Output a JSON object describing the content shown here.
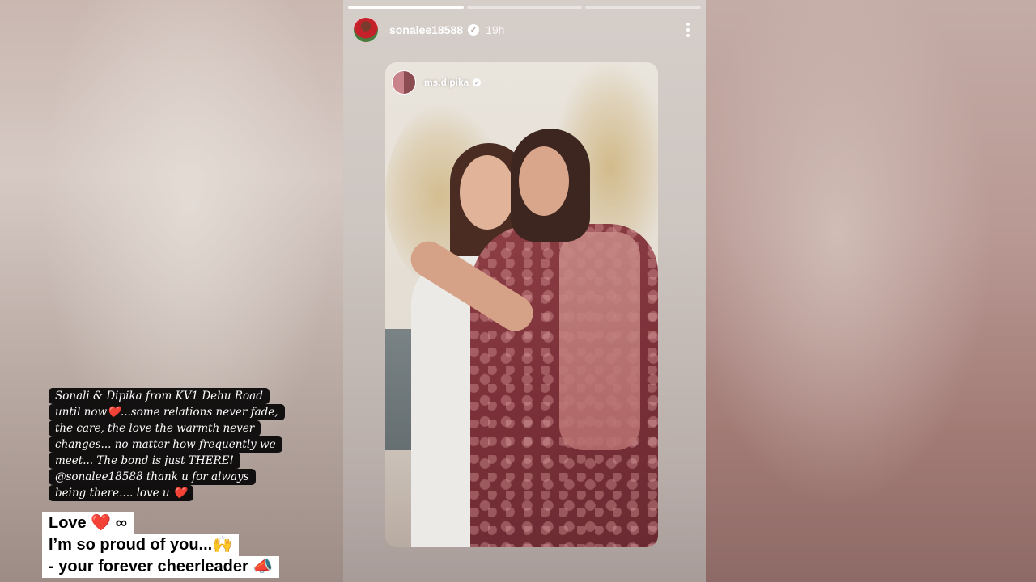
{
  "story": {
    "username": "sonalee18588",
    "time_ago": "19h",
    "progress": {
      "segments_total": 3,
      "segments_completed": 1
    }
  },
  "shared_post": {
    "username": "ms.dipika",
    "caption_lines": [
      "Sonali & Dipika from KV1 Dehu Road",
      "until now❤️...some relations never fade,",
      "the care, the love the warmth never",
      "changes... no matter how frequently we",
      "meet... The bond is just THERE!",
      "@sonalee18588 thank u for always",
      "being there.... love u ❤️"
    ]
  },
  "sticker": {
    "line1": "Love ❤️ ∞",
    "line2": "I’m so proud of you...🙌",
    "line3": "- your forever cheerleader 📣"
  },
  "icons": [
    "verified-badge-icon",
    "more-options-icon"
  ]
}
